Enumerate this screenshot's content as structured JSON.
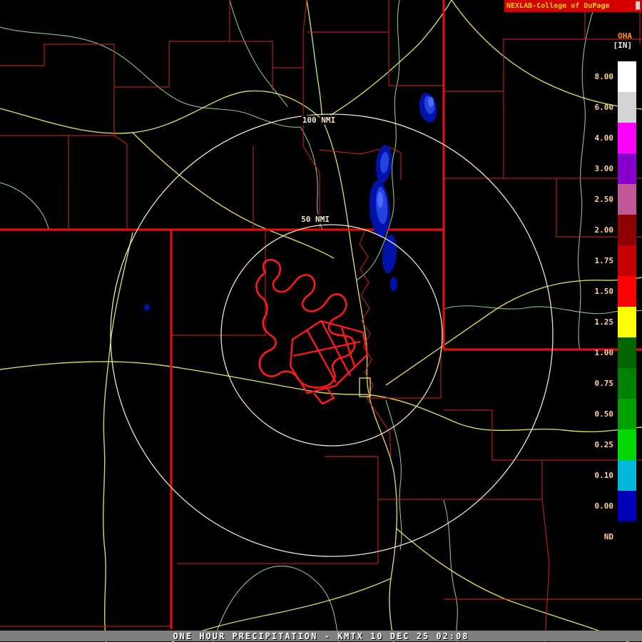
{
  "header": {
    "brand": "NEXLAB-College of DuPage",
    "logo_glyph": "▓"
  },
  "product": {
    "code": "OHA",
    "units": "[IN]"
  },
  "colorbar": {
    "segments": [
      {
        "label": "8.00",
        "style": "background:#ffffff"
      },
      {
        "label": "6.00",
        "style": "background:#d4d4d4"
      },
      {
        "label": "4.00",
        "style": "background:#ff00ff"
      },
      {
        "label": "3.00",
        "style": "background:#8800cc"
      },
      {
        "label": "2.50",
        "style": "background:#c05898"
      },
      {
        "label": "2.00",
        "style": "background:#8e0000"
      },
      {
        "label": "1.75",
        "style": "background:#c40000"
      },
      {
        "label": "1.50",
        "style": "background:#ff0000"
      },
      {
        "label": "1.25",
        "style": "background:#ffff00"
      },
      {
        "label": "1.00",
        "style": "background:#006400"
      },
      {
        "label": "0.75",
        "style": "background:#008000"
      },
      {
        "label": "0.50",
        "style": "background:#00a000"
      },
      {
        "label": "0.25",
        "style": "background:#00d800"
      },
      {
        "label": "0.10",
        "style": "background:#00b8d8"
      },
      {
        "label": "0.00",
        "style": "background:#0000b8"
      },
      {
        "label": "ND",
        "style": "background:#000000"
      }
    ]
  },
  "map": {
    "range_rings": {
      "outer_label": "100 NMI",
      "inner_label": "50 NMI"
    },
    "colors": {
      "county": "#c22222",
      "state": "#e01010",
      "road": "#e2e260",
      "river": "#90d090",
      "ring": "#f2e4c4",
      "urban": "#ff1a1a",
      "city_box": "#e2e260",
      "precip_dark": "#0012a8",
      "precip_mid": "#2342e0",
      "precip_bright": "#4d6aff"
    }
  },
  "statusbar": {
    "text": "ONE HOUR PRECIPITATION - KMTX 10 DEC 25 02:08"
  }
}
